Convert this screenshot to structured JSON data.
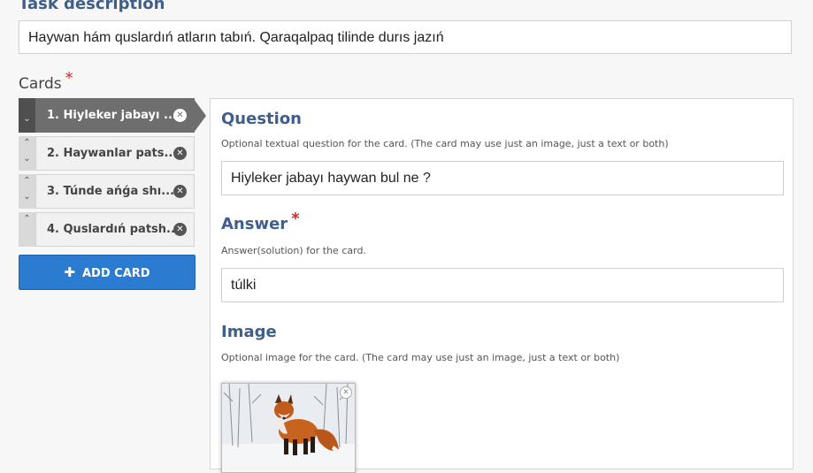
{
  "task": {
    "label": "Task description",
    "required_mark": "*",
    "value": "Haywan hám quslardıń atların tabıń. Qaraqalpaq tilinde durıs jazıń"
  },
  "cards": {
    "label": "Cards",
    "required_mark": "*",
    "items": [
      {
        "label": "1. Hiyleker jabayı ...",
        "active": true
      },
      {
        "label": "2. Haywanlar pats...",
        "active": false
      },
      {
        "label": "3. Túnde ańǵa shı...",
        "active": false
      },
      {
        "label": "4. Quslardıń patsh...",
        "active": false
      }
    ],
    "add_button": {
      "icon": "plus-icon",
      "label": "ADD CARD"
    }
  },
  "editor": {
    "question": {
      "title": "Question",
      "help": "Optional textual question for the card. (The card may use just an image, just a text or both)",
      "value": "Hiyleker jabayı haywan bul ne ?"
    },
    "answer": {
      "title": "Answer",
      "required_mark": "*",
      "help": "Answer(solution) for the card.",
      "value": "túlki"
    },
    "image": {
      "title": "Image",
      "help": "Optional image for the card. (The card may use just an image, just a text or both)",
      "icon": "close-icon"
    }
  },
  "colors": {
    "heading": "#3f5e88",
    "required": "#d02a2a",
    "active_card": "#6e6e6e",
    "add_button": "#2b7bd0"
  }
}
